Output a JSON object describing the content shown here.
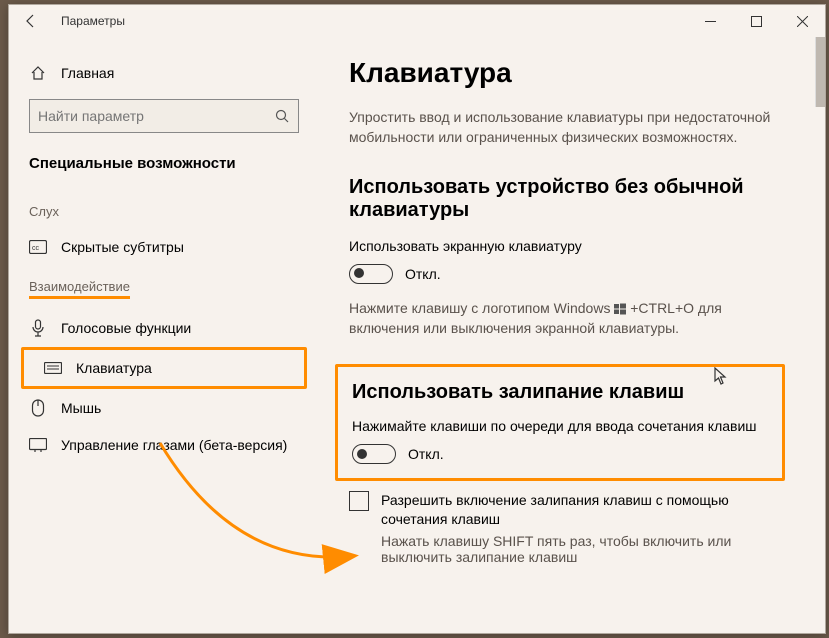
{
  "titlebar": {
    "title": "Параметры"
  },
  "sidebar": {
    "home": "Главная",
    "search_placeholder": "Найти параметр",
    "section": "Специальные возможности",
    "group_hearing": "Слух",
    "item_captions": "Скрытые субтитры",
    "group_interaction": "Взаимодействие",
    "item_speech": "Голосовые функции",
    "item_keyboard": "Клавиатура",
    "item_mouse": "Мышь",
    "item_eyecontrol": "Управление глазами (бета-версия)"
  },
  "main": {
    "h1": "Клавиатура",
    "sub": "Упростить ввод и использование клавиатуры при недостаточной мобильности или ограниченных физических возможностях.",
    "h2_osk": "Использовать устройство без обычной клавиатуры",
    "osk_label": "Использовать экранную клавиатуру",
    "off": "Откл.",
    "osk_hint_a": "Нажмите клавишу с логотипом Windows ",
    "osk_hint_b": " +CTRL+O для включения или выключения экранной клавиатуры.",
    "h2_sticky": "Использовать залипание клавиш",
    "sticky_label": "Нажимайте клавиши по очереди для ввода сочетания клавиш",
    "checkbox_label": "Разрешить включение залипания клавиш с помощью сочетания клавиш",
    "checkbox_hint": "Нажать клавишу SHIFT пять раз, чтобы включить или выключить залипание клавиш"
  }
}
